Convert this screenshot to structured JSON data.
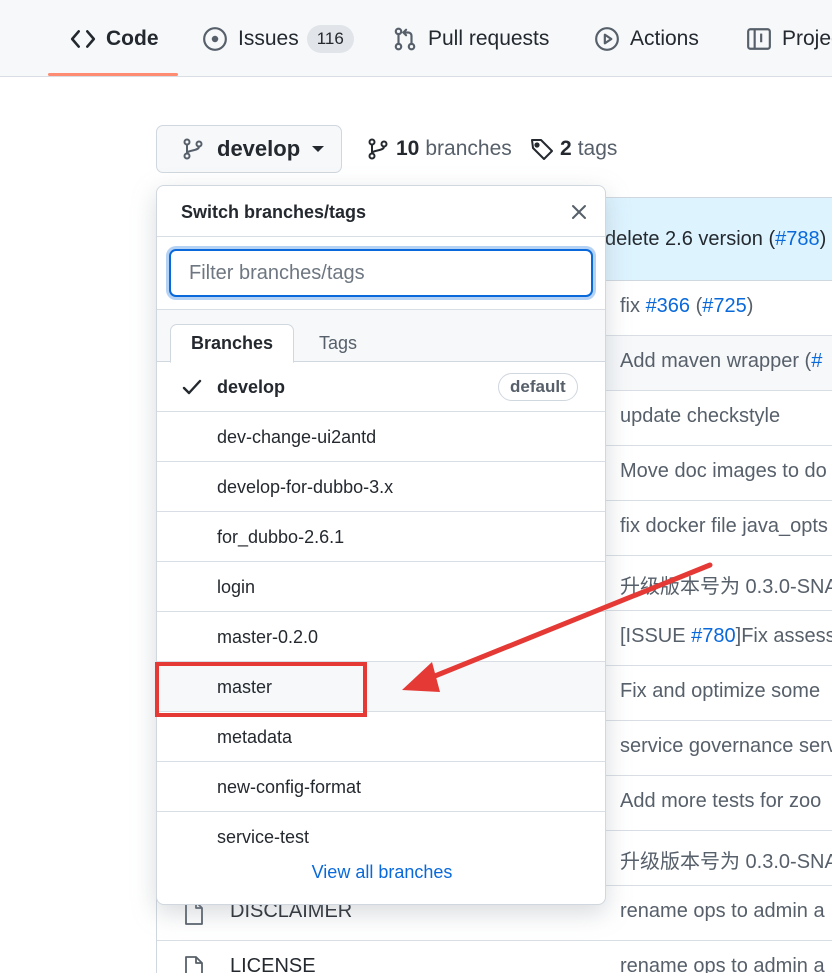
{
  "nav": {
    "tabs": [
      {
        "label": "Code",
        "icon": "code-icon",
        "active": true
      },
      {
        "label": "Issues",
        "icon": "issue-opened-icon",
        "count": "116"
      },
      {
        "label": "Pull requests",
        "icon": "git-pull-request-icon"
      },
      {
        "label": "Actions",
        "icon": "play-icon"
      },
      {
        "label": "Projec",
        "icon": "table-icon"
      }
    ]
  },
  "repo": {
    "current_branch": "develop",
    "branches_count": "10",
    "branches_label": "branches",
    "tags_count": "2",
    "tags_label": "tags"
  },
  "dropdown": {
    "title": "Switch branches/tags",
    "filter_placeholder": "Filter branches/tags",
    "filter_value": "",
    "tabs": [
      "Branches",
      "Tags"
    ],
    "active_tab": "Branches",
    "default_badge": "default",
    "branches": [
      "develop",
      "dev-change-ui2antd",
      "develop-for-dubbo-3.x",
      "for_dubbo-2.6.1",
      "login",
      "master-0.2.0",
      "master",
      "metadata",
      "new-config-format",
      "service-test"
    ],
    "selected_branch": "develop",
    "highlighted_branch": "master",
    "view_all": "View all branches"
  },
  "files": {
    "latest_commit": {
      "prefix": "delete 2.6 version (",
      "link": "#788",
      "suffix": ")"
    },
    "rows": [
      {
        "commit": "fix ",
        "link1": "#366",
        "mid": " (",
        "link2": "#725",
        "end": ")"
      },
      {
        "commit": "Add maven wrapper (",
        "link1": "#"
      },
      {
        "commit": "update checkstyle"
      },
      {
        "commit": "Move doc images to do"
      },
      {
        "commit": "fix docker file java_opts"
      },
      {
        "commit": "升级版本号为 0.3.0-SNA"
      },
      {
        "commit": "[ISSUE ",
        "link1": "#780",
        "end": "]Fix assesse"
      },
      {
        "commit": "Fix and optimize some"
      },
      {
        "commit": "service governance serv"
      },
      {
        "commit": "Add more tests for zoo"
      },
      {
        "commit": "升级版本号为 0.3.0-SNA"
      },
      {
        "name": "DISCLAIMER",
        "commit": "rename ops to admin a"
      },
      {
        "name": "LICENSE",
        "commit": "rename ops to admin a"
      }
    ]
  },
  "annotation": {
    "color": "#e53935"
  },
  "colors": {
    "accent": "#0969da",
    "tab_underline": "#fd8c73",
    "annotation": "#e53935"
  }
}
